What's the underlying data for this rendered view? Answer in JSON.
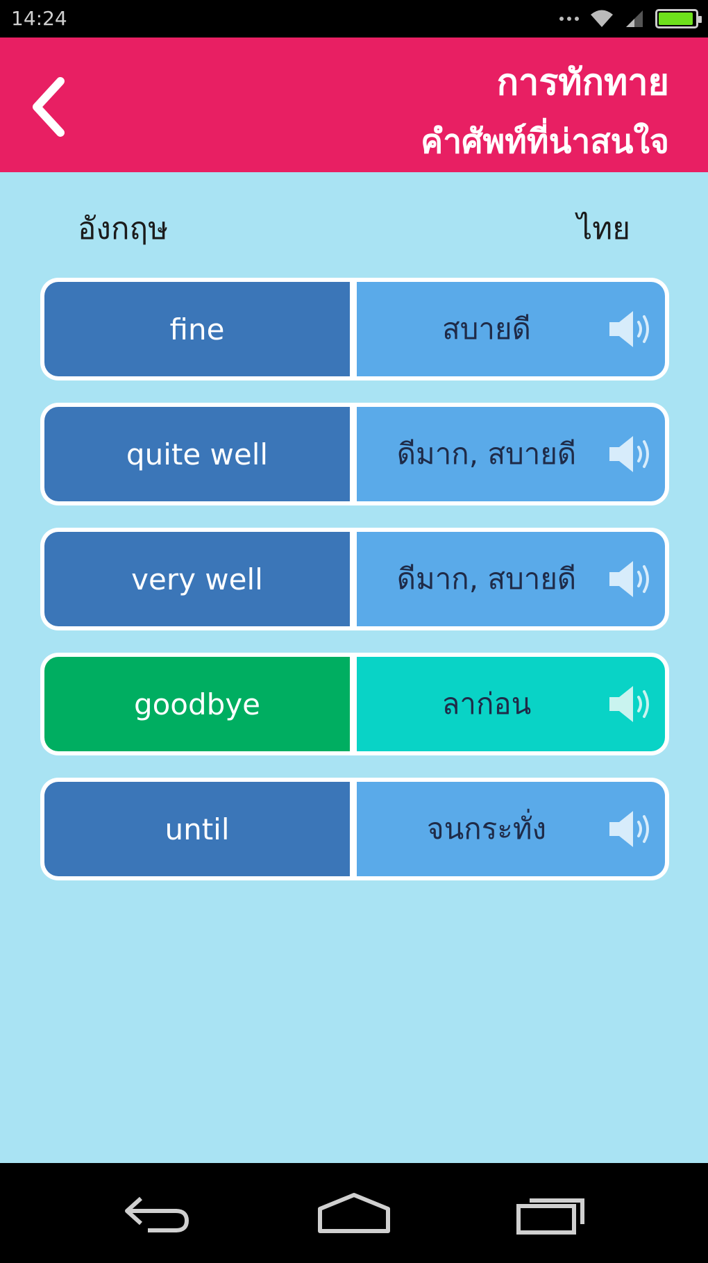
{
  "status_bar": {
    "time": "14:24",
    "battery_level": 0.95,
    "battery_color": "#6ee11c"
  },
  "header": {
    "title": "การทักทาย",
    "subtitle": "คำศัพท์ที่น่าสนใจ",
    "back_icon": "chevron-left-icon",
    "background": "#e81f63"
  },
  "columns": {
    "english": "อังกฤษ",
    "thai": "ไทย"
  },
  "words": [
    {
      "english": "fine",
      "thai": "สบายดี",
      "style": "blue"
    },
    {
      "english": "quite well",
      "thai": "ดีมาก, สบายดี",
      "style": "blue"
    },
    {
      "english": "very well",
      "thai": "ดีมาก, สบายดี",
      "style": "blue"
    },
    {
      "english": "goodbye",
      "thai": "ลาก่อน",
      "style": "green"
    },
    {
      "english": "until",
      "thai": "จนกระทั่ง",
      "style": "blue"
    }
  ],
  "colors": {
    "background": "#a9e3f3",
    "english_cell": "#3b76b8",
    "thai_cell": "#5aaae9",
    "selected_english_cell": "#00ae61",
    "selected_thai_cell": "#09d3c6"
  },
  "nav_bar": {
    "icons": [
      "back-icon",
      "home-icon",
      "recent-apps-icon"
    ]
  }
}
